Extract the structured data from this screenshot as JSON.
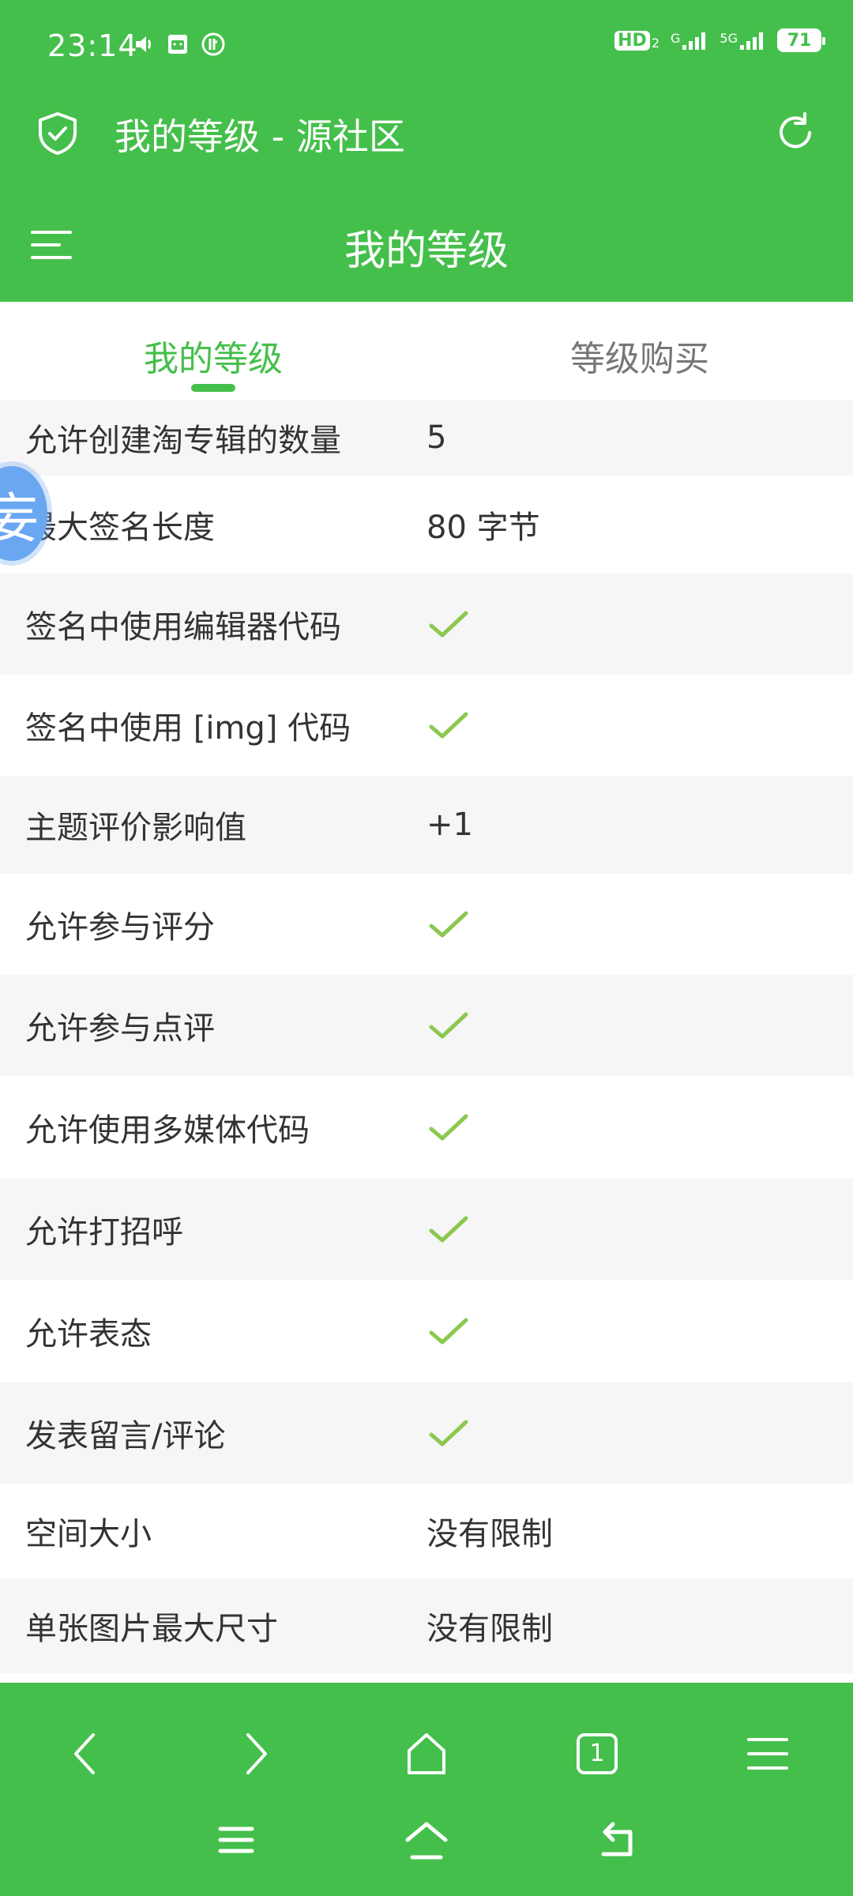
{
  "status_bar": {
    "time": "23:14",
    "network_hd": "HD",
    "network_hd_sub": "2",
    "network_g": "G",
    "network_5g": "5G",
    "battery": "71"
  },
  "browser_title": "我的等级 - 源社区",
  "page_header": "我的等级",
  "tabs": [
    {
      "label": "我的等级",
      "active": true
    },
    {
      "label": "等级购买",
      "active": false
    }
  ],
  "floating_avatar_text": "妄",
  "rows": [
    {
      "label": "允许创建淘专辑的数量",
      "value": "5",
      "type": "text"
    },
    {
      "label": "最大签名长度",
      "value": "80 字节",
      "type": "text"
    },
    {
      "label": "签名中使用编辑器代码",
      "value": "",
      "type": "check"
    },
    {
      "label": "签名中使用 [img] 代码",
      "value": "",
      "type": "check"
    },
    {
      "label": "主题评价影响值",
      "value": "+1",
      "type": "text"
    },
    {
      "label": "允许参与评分",
      "value": "",
      "type": "check"
    },
    {
      "label": "允许参与点评",
      "value": "",
      "type": "check"
    },
    {
      "label": "允许使用多媒体代码",
      "value": "",
      "type": "check"
    },
    {
      "label": "允许打招呼",
      "value": "",
      "type": "check"
    },
    {
      "label": "允许表态",
      "value": "",
      "type": "check"
    },
    {
      "label": "发表留言/评论",
      "value": "",
      "type": "check"
    },
    {
      "label": "空间大小",
      "value": "没有限制",
      "type": "text"
    },
    {
      "label": "单张图片最大尺寸",
      "value": "没有限制",
      "type": "text"
    }
  ],
  "bottom_nav": {
    "tab_count": "1"
  },
  "colors": {
    "brand_green": "#45bf4b",
    "check_green": "#8bc84f",
    "row_alt": "#f6f6f6"
  }
}
